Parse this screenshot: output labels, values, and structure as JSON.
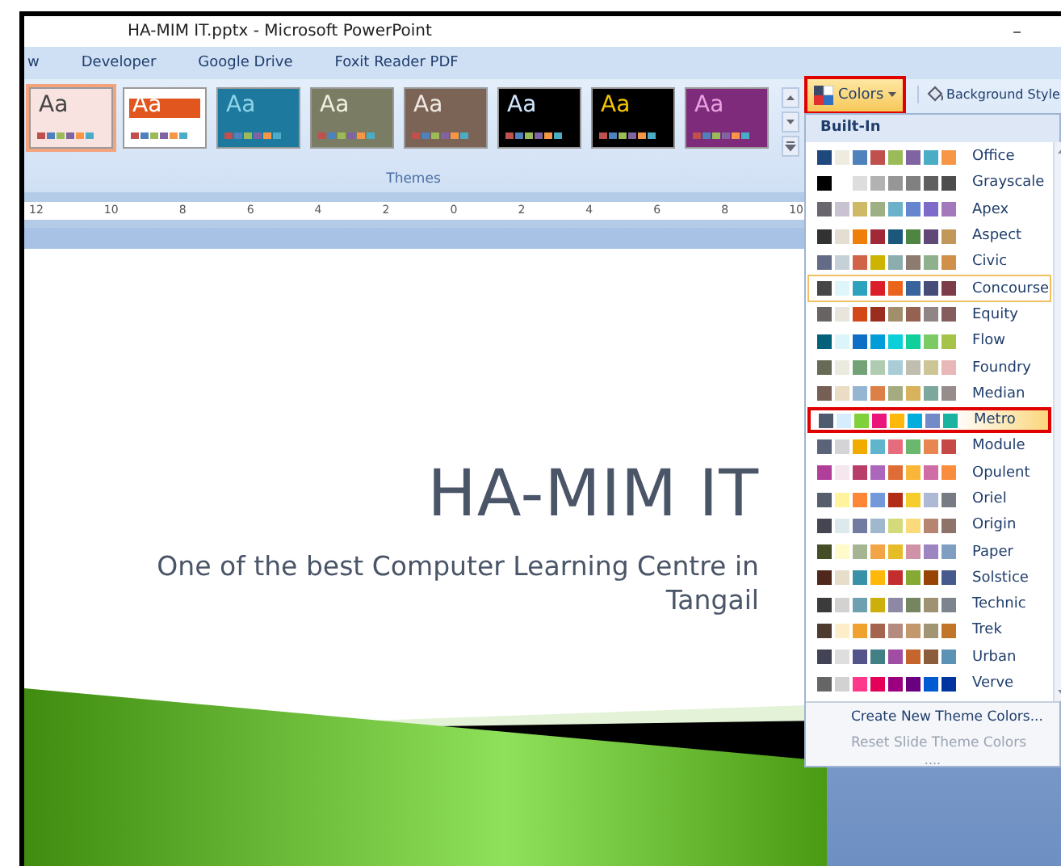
{
  "window": {
    "title": "HA-MIM IT.pptx - Microsoft PowerPoint",
    "minimize": "–"
  },
  "tabs": [
    {
      "label": "w",
      "selected": false
    },
    {
      "label": "Developer",
      "selected": false
    },
    {
      "label": "Google Drive",
      "selected": false
    },
    {
      "label": "Foxit Reader PDF",
      "selected": false
    }
  ],
  "themes_gallery": {
    "label": "Themes",
    "items": [
      {
        "kind": "plain",
        "selected": true,
        "color": "#f9e3e0",
        "sample": {
          "text": "Aa",
          "color": "#444444"
        }
      },
      {
        "kind": "band",
        "selected": false,
        "color": "#ffffff",
        "sample": {
          "text": "Aa",
          "color": "#ffffff"
        }
      },
      {
        "kind": "plain",
        "selected": false,
        "color": "#1d7a9e",
        "sample": {
          "text": "Aa",
          "color": "#8fd3e8"
        }
      },
      {
        "kind": "plain",
        "selected": false,
        "color": "#7a7d63",
        "sample": {
          "text": "Aa",
          "color": "#f0f0e0"
        }
      },
      {
        "kind": "plain",
        "selected": false,
        "color": "#7b6356",
        "sample": {
          "text": "Aa",
          "color": "#f0e8e0"
        }
      },
      {
        "kind": "plain",
        "selected": false,
        "color": "#000000",
        "sample": {
          "text": "Aa",
          "color": "#cfe6ff"
        }
      },
      {
        "kind": "plain",
        "selected": false,
        "color": "#000000",
        "sample": {
          "text": "Aa",
          "color": "#f5c400"
        }
      },
      {
        "kind": "plain",
        "selected": false,
        "color": "#7d2b7a",
        "sample": {
          "text": "Aa",
          "color": "#e8a0e0"
        }
      }
    ]
  },
  "colors_button": {
    "label": "Colors",
    "open": true
  },
  "background_styles_button": {
    "label": "Background Style"
  },
  "ruler": {
    "labels": [
      "12",
      "10",
      "8",
      "6",
      "4",
      "2",
      "0",
      "2",
      "4",
      "6",
      "8",
      "10"
    ]
  },
  "slide": {
    "title": "HA-MIM IT",
    "subtitle": "One of the best Computer Learning Centre in Tangail"
  },
  "colors_menu": {
    "header": "Built-In",
    "schemes": [
      {
        "name": "Office",
        "selected": false,
        "hovered": false,
        "swatches": [
          {
            "color": "#1f497d"
          },
          {
            "color": "#eeece1"
          },
          {
            "color": "#4f81bd"
          },
          {
            "color": "#c0504d"
          },
          {
            "color": "#9bbb59"
          },
          {
            "color": "#8064a2"
          },
          {
            "color": "#4bacc6"
          },
          {
            "color": "#f79646"
          }
        ]
      },
      {
        "name": "Grayscale",
        "selected": false,
        "hovered": false,
        "swatches": [
          {
            "color": "#000000"
          },
          {
            "color": "#ffffff"
          },
          {
            "color": "#dddddd"
          },
          {
            "color": "#b2b2b2"
          },
          {
            "color": "#969696"
          },
          {
            "color": "#808080"
          },
          {
            "color": "#5f5f5f"
          },
          {
            "color": "#4d4d4d"
          }
        ]
      },
      {
        "name": "Apex",
        "selected": false,
        "hovered": false,
        "swatches": [
          {
            "color": "#69676d"
          },
          {
            "color": "#c9c2d1"
          },
          {
            "color": "#ceb966"
          },
          {
            "color": "#9cb084"
          },
          {
            "color": "#6bb1c9"
          },
          {
            "color": "#6585cf"
          },
          {
            "color": "#7e6bc9"
          },
          {
            "color": "#a379bb"
          }
        ]
      },
      {
        "name": "Aspect",
        "selected": false,
        "hovered": false,
        "swatches": [
          {
            "color": "#323232"
          },
          {
            "color": "#e3ded1"
          },
          {
            "color": "#f07f09"
          },
          {
            "color": "#9f2936"
          },
          {
            "color": "#1b587c"
          },
          {
            "color": "#4e8542"
          },
          {
            "color": "#604878"
          },
          {
            "color": "#c19859"
          }
        ]
      },
      {
        "name": "Civic",
        "selected": false,
        "hovered": false,
        "swatches": [
          {
            "color": "#646b86"
          },
          {
            "color": "#c5d1d7"
          },
          {
            "color": "#d16349"
          },
          {
            "color": "#ccb400"
          },
          {
            "color": "#8cadae"
          },
          {
            "color": "#8c7b70"
          },
          {
            "color": "#8fb08c"
          },
          {
            "color": "#d19049"
          }
        ]
      },
      {
        "name": "Concourse",
        "selected": false,
        "hovered": true,
        "swatches": [
          {
            "color": "#464646"
          },
          {
            "color": "#def5fa"
          },
          {
            "color": "#2da2bf"
          },
          {
            "color": "#da1f28"
          },
          {
            "color": "#eb641b"
          },
          {
            "color": "#39639d"
          },
          {
            "color": "#474b78"
          },
          {
            "color": "#7d3c4a"
          }
        ]
      },
      {
        "name": "Equity",
        "selected": false,
        "hovered": false,
        "swatches": [
          {
            "color": "#696464"
          },
          {
            "color": "#e9e5dc"
          },
          {
            "color": "#d34817"
          },
          {
            "color": "#9b2d1f"
          },
          {
            "color": "#a28e6a"
          },
          {
            "color": "#956251"
          },
          {
            "color": "#918485"
          },
          {
            "color": "#855d5d"
          }
        ]
      },
      {
        "name": "Flow",
        "selected": false,
        "hovered": false,
        "swatches": [
          {
            "color": "#04617b"
          },
          {
            "color": "#dbf5f9"
          },
          {
            "color": "#0f6fc6"
          },
          {
            "color": "#009dd9"
          },
          {
            "color": "#0bd0d9"
          },
          {
            "color": "#10cf9b"
          },
          {
            "color": "#7cca62"
          },
          {
            "color": "#a5c249"
          }
        ]
      },
      {
        "name": "Foundry",
        "selected": false,
        "hovered": false,
        "swatches": [
          {
            "color": "#676a55"
          },
          {
            "color": "#eaebde"
          },
          {
            "color": "#72a376"
          },
          {
            "color": "#b0ccb0"
          },
          {
            "color": "#a8cdd7"
          },
          {
            "color": "#c0beaf"
          },
          {
            "color": "#cec597"
          },
          {
            "color": "#e8b7b7"
          }
        ]
      },
      {
        "name": "Median",
        "selected": false,
        "hovered": false,
        "swatches": [
          {
            "color": "#775f55"
          },
          {
            "color": "#ebddc3"
          },
          {
            "color": "#94b6d2"
          },
          {
            "color": "#dd8047"
          },
          {
            "color": "#a5ab81"
          },
          {
            "color": "#d8b25c"
          },
          {
            "color": "#7ba79d"
          },
          {
            "color": "#968c8c"
          }
        ]
      },
      {
        "name": "Metro",
        "selected": true,
        "hovered": false,
        "swatches": [
          {
            "color": "#4e5b6f"
          },
          {
            "color": "#d6ecff"
          },
          {
            "color": "#7fd13b"
          },
          {
            "color": "#ea157a"
          },
          {
            "color": "#feb80a"
          },
          {
            "color": "#00addc"
          },
          {
            "color": "#738ac8"
          },
          {
            "color": "#1ab39f"
          }
        ]
      },
      {
        "name": "Module",
        "selected": false,
        "hovered": false,
        "swatches": [
          {
            "color": "#5a6378"
          },
          {
            "color": "#d4d4d6"
          },
          {
            "color": "#f0ad00"
          },
          {
            "color": "#60b5cc"
          },
          {
            "color": "#e66c7d"
          },
          {
            "color": "#6bb76d"
          },
          {
            "color": "#e88651"
          },
          {
            "color": "#c64847"
          }
        ]
      },
      {
        "name": "Opulent",
        "selected": false,
        "hovered": false,
        "swatches": [
          {
            "color": "#b13f9a"
          },
          {
            "color": "#f4e7ed"
          },
          {
            "color": "#b83d68"
          },
          {
            "color": "#ac66bb"
          },
          {
            "color": "#de6c36"
          },
          {
            "color": "#f9b639"
          },
          {
            "color": "#cf6da4"
          },
          {
            "color": "#fa8d3d"
          }
        ]
      },
      {
        "name": "Oriel",
        "selected": false,
        "hovered": false,
        "swatches": [
          {
            "color": "#575f6d"
          },
          {
            "color": "#fff39d"
          },
          {
            "color": "#fe8637"
          },
          {
            "color": "#7598d9"
          },
          {
            "color": "#b32c16"
          },
          {
            "color": "#f5cd2d"
          },
          {
            "color": "#aebad5"
          },
          {
            "color": "#777c84"
          }
        ]
      },
      {
        "name": "Origin",
        "selected": false,
        "hovered": false,
        "swatches": [
          {
            "color": "#464653"
          },
          {
            "color": "#dde9ec"
          },
          {
            "color": "#727ca3"
          },
          {
            "color": "#9fb8cd"
          },
          {
            "color": "#d2da7a"
          },
          {
            "color": "#fada7a"
          },
          {
            "color": "#b88472"
          },
          {
            "color": "#8e736a"
          }
        ]
      },
      {
        "name": "Paper",
        "selected": false,
        "hovered": false,
        "swatches": [
          {
            "color": "#444d26"
          },
          {
            "color": "#fefac9"
          },
          {
            "color": "#a5b592"
          },
          {
            "color": "#f3a447"
          },
          {
            "color": "#e7bc29"
          },
          {
            "color": "#d092a7"
          },
          {
            "color": "#9c85c0"
          },
          {
            "color": "#809ec2"
          }
        ]
      },
      {
        "name": "Solstice",
        "selected": false,
        "hovered": false,
        "swatches": [
          {
            "color": "#4f271c"
          },
          {
            "color": "#e7dec9"
          },
          {
            "color": "#3891a7"
          },
          {
            "color": "#feb80a"
          },
          {
            "color": "#c32d2e"
          },
          {
            "color": "#84aa33"
          },
          {
            "color": "#964305"
          },
          {
            "color": "#475a8d"
          }
        ]
      },
      {
        "name": "Technic",
        "selected": false,
        "hovered": false,
        "swatches": [
          {
            "color": "#3b3b3b"
          },
          {
            "color": "#d4d2d0"
          },
          {
            "color": "#6ea0b0"
          },
          {
            "color": "#ccaf0a"
          },
          {
            "color": "#8d89a4"
          },
          {
            "color": "#748560"
          },
          {
            "color": "#9e9273"
          },
          {
            "color": "#7e848d"
          }
        ]
      },
      {
        "name": "Trek",
        "selected": false,
        "hovered": false,
        "swatches": [
          {
            "color": "#4e3b30"
          },
          {
            "color": "#fbeec9"
          },
          {
            "color": "#f0a22e"
          },
          {
            "color": "#a5644e"
          },
          {
            "color": "#b58b80"
          },
          {
            "color": "#c3986d"
          },
          {
            "color": "#a19574"
          },
          {
            "color": "#c17529"
          }
        ]
      },
      {
        "name": "Urban",
        "selected": false,
        "hovered": false,
        "swatches": [
          {
            "color": "#424456"
          },
          {
            "color": "#dedede"
          },
          {
            "color": "#53548a"
          },
          {
            "color": "#438086"
          },
          {
            "color": "#a04da3"
          },
          {
            "color": "#c4652d"
          },
          {
            "color": "#8b5d3d"
          },
          {
            "color": "#5c92b5"
          }
        ]
      },
      {
        "name": "Verve",
        "selected": false,
        "hovered": false,
        "swatches": [
          {
            "color": "#666666"
          },
          {
            "color": "#d2d2d2"
          },
          {
            "color": "#ff388c"
          },
          {
            "color": "#e40059"
          },
          {
            "color": "#9c007f"
          },
          {
            "color": "#68007f"
          },
          {
            "color": "#005bd3"
          },
          {
            "color": "#00349e"
          }
        ]
      }
    ],
    "actions": [
      {
        "label": "Create New Theme Colors...",
        "disabled": false
      },
      {
        "label": "Reset Slide Theme Colors",
        "disabled": true
      }
    ],
    "grip": "...."
  }
}
